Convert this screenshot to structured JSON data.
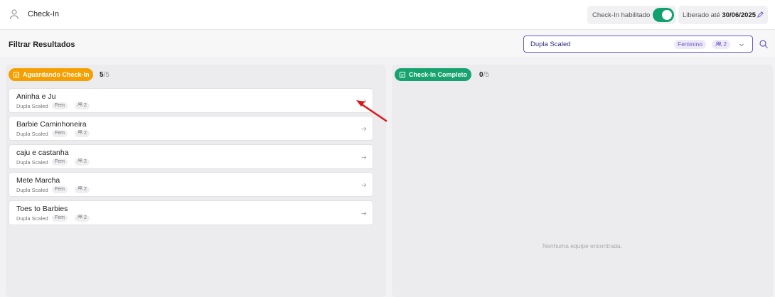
{
  "header": {
    "title": "Check-In",
    "checkin_label": "Check-In habilitado",
    "checkin_enabled": true,
    "liberado_label": "Liberado até",
    "liberado_date": "30/06/2025"
  },
  "filter": {
    "title": "Filtrar Resultados",
    "selected": "Dupla Scaled",
    "gender": "Feminino",
    "team_size": "2"
  },
  "pending": {
    "label": "Aguardando Check-In",
    "count": "5",
    "total": "/5",
    "items": [
      {
        "name": "Aninha e Ju",
        "category": "Dupla Scaled",
        "gender": "Fem",
        "size": "2"
      },
      {
        "name": "Barbie Caminhoneira",
        "category": "Dupla Scaled",
        "gender": "Fem",
        "size": "2"
      },
      {
        "name": "caju e castanha",
        "category": "Dupla Scaled",
        "gender": "Fem",
        "size": "2"
      },
      {
        "name": "Mete Marcha",
        "category": "Dupla Scaled",
        "gender": "Fem",
        "size": "2"
      },
      {
        "name": "Toes to Barbies",
        "category": "Dupla Scaled",
        "gender": "Fem",
        "size": "2"
      }
    ]
  },
  "completed": {
    "label": "Check-In Completo",
    "count": "0",
    "total": "/5",
    "empty_text": "Nenhuma equipe encontrada."
  },
  "colors": {
    "accent": "#6a58c9",
    "pending": "#f5a000",
    "completed": "#16a36f",
    "annotation": "#e0141c"
  },
  "icons": [
    "user-icon",
    "pencil-icon",
    "chevron-down-icon",
    "search-icon",
    "people-icon",
    "clipboard-icon",
    "arrow-right-icon"
  ]
}
